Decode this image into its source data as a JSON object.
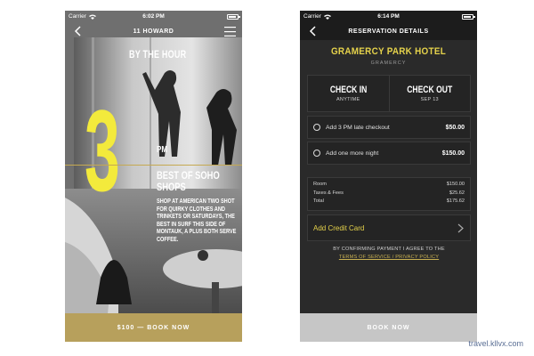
{
  "left_phone": {
    "status": {
      "carrier": "Carrier",
      "time": "6:02 PM"
    },
    "nav": {
      "title": "11 HOWARD"
    },
    "hero": {
      "kicker": "BY THE HOUR",
      "number": "3",
      "time_suffix": "PM",
      "title": "BEST OF SOHO SHOPS",
      "description": "SHOP AT AMERICAN TWO SHOT FOR QUIRKY CLOTHES AND TRINKETS OR SATURDAYS, THE BEST IN SURF THIS SIDE OF MONTAUK, A PLUS BOTH SERVE COFFEE."
    },
    "book_label": "$100 — BOOK NOW"
  },
  "right_phone": {
    "status": {
      "carrier": "Carrier",
      "time": "6:14 PM"
    },
    "nav": {
      "title": "RESERVATION DETAILS"
    },
    "hotel": {
      "name": "GRAMERCY PARK HOTEL",
      "subtitle": "GRAMERCY"
    },
    "check_in": {
      "label": "CHECK IN",
      "value": "ANYTIME"
    },
    "check_out": {
      "label": "CHECK OUT",
      "value": "SEP 13"
    },
    "options": [
      {
        "label": "Add 3 PM late checkout",
        "price": "$50.00"
      },
      {
        "label": "Add one more night",
        "price": "$150.00"
      }
    ],
    "summary": [
      {
        "label": "Room",
        "value": "$150.00"
      },
      {
        "label": "Taxes & Fees",
        "value": "$25.62"
      },
      {
        "label": "Total",
        "value": "$175.62"
      }
    ],
    "credit_label": "Add Credit Card",
    "confirm_text": "BY CONFIRMING PAYMENT I AGREE TO THE",
    "terms_link": "TERMS OF SERVICE / PRIVACY POLICY",
    "book_label": "BOOK NOW"
  },
  "watermark": "travel.kllvx.com",
  "colors": {
    "accent_yellow": "#f3ea3c",
    "gold": "#b7a05c",
    "hotel_yellow": "#e5d24b"
  },
  "icons": [
    "back-chevron-icon",
    "menu-icon",
    "wifi-icon",
    "battery-icon",
    "chevron-right-icon"
  ]
}
